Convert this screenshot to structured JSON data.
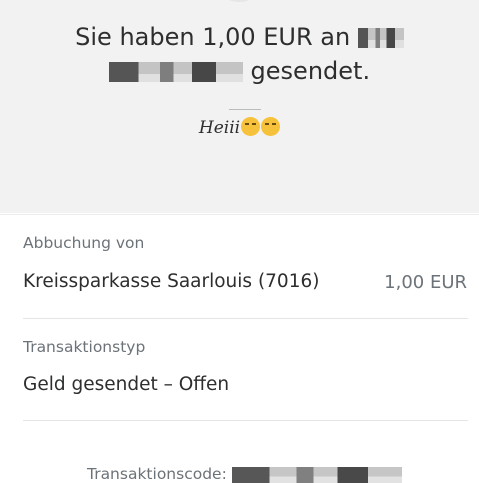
{
  "confirmation": {
    "text_part1": "Sie haben 1,00 EUR an",
    "text_part2": "gesendet."
  },
  "note": {
    "text": "Heiii",
    "emojis": [
      "smirking-face-emoji",
      "tears-of-joy-emoji"
    ]
  },
  "debit": {
    "label": "Abbuchung von",
    "account": "Kreissparkasse Saarlouis (7016)",
    "amount": "1,00 EUR"
  },
  "transaction_type": {
    "label": "Transaktionstyp",
    "value": "Geld gesendet – Offen"
  },
  "transaction_code": {
    "label": "Transaktionscode:"
  },
  "colors": {
    "hero_background": "#f2f2f2",
    "primary_text": "#2c2e2f",
    "secondary_text": "#6c7378",
    "divider": "#e5e5e5"
  }
}
